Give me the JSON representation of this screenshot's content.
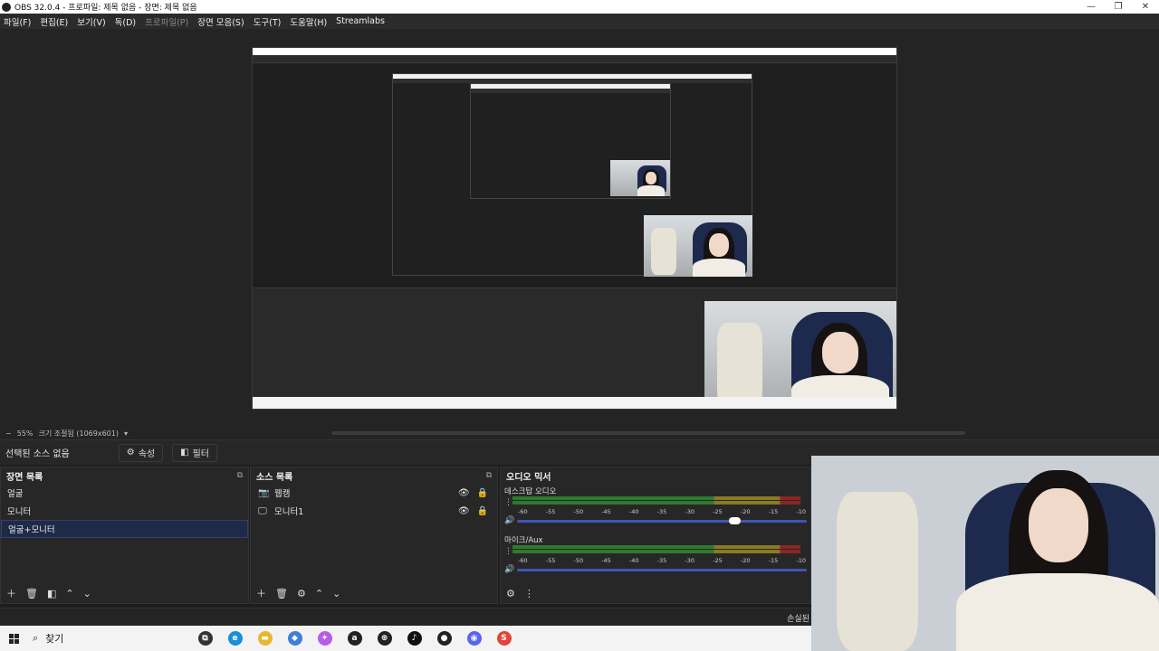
{
  "window": {
    "title": "OBS 32.0.4 - 프로파일: 제목 없음 - 장면: 제목 없음",
    "minimize": "—",
    "restore": "❐",
    "close": "✕"
  },
  "menu": [
    {
      "label": "파일(F)",
      "disabled": false
    },
    {
      "label": "편집(E)",
      "disabled": false
    },
    {
      "label": "보기(V)",
      "disabled": false
    },
    {
      "label": "독(D)",
      "disabled": false
    },
    {
      "label": "프로파일(P)",
      "disabled": true
    },
    {
      "label": "장면 모음(S)",
      "disabled": false
    },
    {
      "label": "도구(T)",
      "disabled": false
    },
    {
      "label": "도움말(H)",
      "disabled": false
    },
    {
      "label": "Streamlabs",
      "disabled": false
    }
  ],
  "zoom": {
    "minus": "−",
    "level": "55%",
    "size_label": "크기 조절됨 (1069x601)",
    "dropdown": "▾"
  },
  "source_toolbar": {
    "no_source": "선택된 소스 없음",
    "properties": "속성",
    "filters": "필터"
  },
  "scenes": {
    "title": "장면 목록",
    "items": [
      {
        "label": "얼굴",
        "selected": false
      },
      {
        "label": "모니터",
        "selected": false
      },
      {
        "label": "얼굴+모니터",
        "selected": true
      }
    ]
  },
  "sources": {
    "title": "소스 목록",
    "items": [
      {
        "label": "웹캠",
        "icon": "camera-icon"
      },
      {
        "label": "모니터1",
        "icon": "monitor-icon"
      }
    ]
  },
  "mixer": {
    "title": "오디오 믹서",
    "scale": [
      "-60",
      "-55",
      "-50",
      "-45",
      "-40",
      "-35",
      "-30",
      "-25",
      "-20",
      "-15",
      "-10"
    ],
    "tracks": [
      {
        "name": "데스크탑 오디오",
        "volume": 0.73
      },
      {
        "name": "마이크/Aux",
        "volume": 1.0
      }
    ]
  },
  "status": {
    "text": "손실된"
  },
  "taskbar": {
    "search_label": "찾기",
    "apps": [
      {
        "icon": "task-view-icon",
        "color": "#333333",
        "glyph": "⧉"
      },
      {
        "icon": "edge-icon",
        "color": "#1a8fd6",
        "glyph": "e"
      },
      {
        "icon": "folder-icon",
        "color": "#e8b731",
        "glyph": "▬"
      },
      {
        "icon": "store-icon",
        "color": "#3f7fe0",
        "glyph": "◆"
      },
      {
        "icon": "copilot-icon",
        "color": "#b85ce8",
        "glyph": "✦"
      },
      {
        "icon": "amazon-icon",
        "color": "#222222",
        "glyph": "a"
      },
      {
        "icon": "chatgpt-icon",
        "color": "#222222",
        "glyph": "⊛"
      },
      {
        "icon": "tiktok-icon",
        "color": "#111111",
        "glyph": "♪"
      },
      {
        "icon": "obs-icon",
        "color": "#222222",
        "glyph": "●"
      },
      {
        "icon": "discord-icon",
        "color": "#5865f2",
        "glyph": "◉"
      },
      {
        "icon": "streamlabs-icon",
        "color": "#e0463a",
        "glyph": "S"
      }
    ]
  }
}
